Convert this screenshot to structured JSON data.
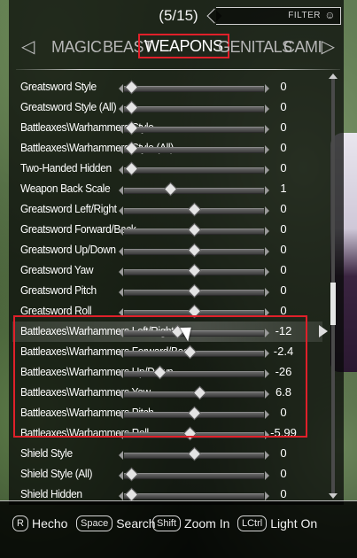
{
  "header": {
    "page_counter": "(5/15)",
    "filter_label": "FILTER",
    "filter_icon": "theater-mask-icon"
  },
  "tabs": [
    {
      "label": "MAGIC",
      "active": false
    },
    {
      "label": "BEAST",
      "active": false
    },
    {
      "label": "WEAPONS",
      "active": true
    },
    {
      "label": "GENITALS",
      "active": false
    },
    {
      "label": "CAMI",
      "active": false
    }
  ],
  "rows": [
    {
      "label": "Greatsword Style",
      "value": "0",
      "fraction": 0.05
    },
    {
      "label": "Greatsword Style (All)",
      "value": "0",
      "fraction": 0.05
    },
    {
      "label": "Battleaxes\\Warhammers Style",
      "value": "0",
      "fraction": 0.05
    },
    {
      "label": "Battleaxes\\Warhammers Style (All)",
      "value": "0",
      "fraction": 0.05
    },
    {
      "label": "Two-Handed Hidden",
      "value": "0",
      "fraction": 0.05
    },
    {
      "label": "Weapon Back Scale",
      "value": "1",
      "fraction": 0.33
    },
    {
      "label": "Greatsword Left/Right",
      "value": "0",
      "fraction": 0.5
    },
    {
      "label": "Greatsword Forward/Back",
      "value": "0",
      "fraction": 0.5
    },
    {
      "label": "Greatsword Up/Down",
      "value": "0",
      "fraction": 0.5
    },
    {
      "label": "Greatsword Yaw",
      "value": "0",
      "fraction": 0.5
    },
    {
      "label": "Greatsword Pitch",
      "value": "0",
      "fraction": 0.5
    },
    {
      "label": "Greatsword Roll",
      "value": "0",
      "fraction": 0.5
    },
    {
      "label": "Battleaxes\\Warhammers Left/Right",
      "value": "-12",
      "fraction": 0.38,
      "selected": true
    },
    {
      "label": "Battleaxes\\Warhammers Forward/Back",
      "value": "-2.4",
      "fraction": 0.47
    },
    {
      "label": "Battleaxes\\Warhammers Up/Down",
      "value": "-26",
      "fraction": 0.25
    },
    {
      "label": "Battleaxes\\Warhammers Yaw",
      "value": "6.8",
      "fraction": 0.54
    },
    {
      "label": "Battleaxes\\Warhammers Pitch",
      "value": "0",
      "fraction": 0.5
    },
    {
      "label": "Battleaxes\\Warhammers Roll",
      "value": "-5.99",
      "fraction": 0.47
    },
    {
      "label": "Shield Style",
      "value": "0",
      "fraction": 0.5
    },
    {
      "label": "Shield Style (All)",
      "value": "0",
      "fraction": 0.05
    },
    {
      "label": "Shield Hidden",
      "value": "0",
      "fraction": 0.05
    }
  ],
  "footer": {
    "hints": [
      {
        "key": "R",
        "label": "Hecho"
      },
      {
        "key": "Space",
        "label": "Search"
      },
      {
        "key": "Shift",
        "label": "Zoom In"
      },
      {
        "key": "LCtrl",
        "label": "Light On"
      }
    ]
  },
  "colors": {
    "highlight": "#e0202a"
  }
}
